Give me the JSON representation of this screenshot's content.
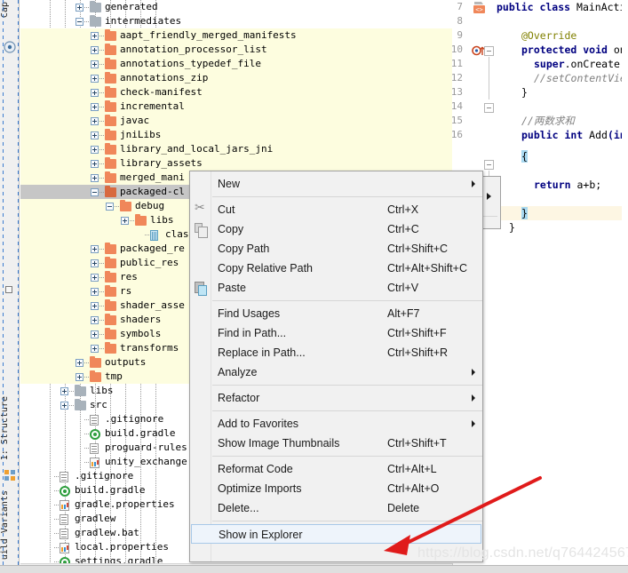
{
  "tool_tabs": [
    {
      "name": "capture-tab",
      "label": "Cap",
      "icon": "capture-icon"
    },
    {
      "name": "structure-tab",
      "label": "1: Structure",
      "icon": "structure-icon"
    },
    {
      "name": "build-variants-tab",
      "label": "uild Variants",
      "icon": "build-variants-icon"
    }
  ],
  "tree": {
    "rows": [
      {
        "label": "generated",
        "indent": 4,
        "icon": "folder-gray",
        "toggle": "plus",
        "highlight": "none"
      },
      {
        "label": "intermediates",
        "indent": 4,
        "icon": "folder-gray",
        "toggle": "minus",
        "highlight": "none"
      },
      {
        "label": "aapt_friendly_merged_manifests",
        "indent": 5,
        "icon": "folder-orange",
        "toggle": "plus",
        "highlight": "yellow"
      },
      {
        "label": "annotation_processor_list",
        "indent": 5,
        "icon": "folder-orange",
        "toggle": "plus",
        "highlight": "yellow"
      },
      {
        "label": "annotations_typedef_file",
        "indent": 5,
        "icon": "folder-orange",
        "toggle": "plus",
        "highlight": "yellow"
      },
      {
        "label": "annotations_zip",
        "indent": 5,
        "icon": "folder-orange",
        "toggle": "plus",
        "highlight": "yellow"
      },
      {
        "label": "check-manifest",
        "indent": 5,
        "icon": "folder-orange",
        "toggle": "plus",
        "highlight": "yellow"
      },
      {
        "label": "incremental",
        "indent": 5,
        "icon": "folder-orange",
        "toggle": "plus",
        "highlight": "yellow"
      },
      {
        "label": "javac",
        "indent": 5,
        "icon": "folder-orange",
        "toggle": "plus",
        "highlight": "yellow"
      },
      {
        "label": "jniLibs",
        "indent": 5,
        "icon": "folder-orange",
        "toggle": "plus",
        "highlight": "yellow"
      },
      {
        "label": "library_and_local_jars_jni",
        "indent": 5,
        "icon": "folder-orange",
        "toggle": "plus",
        "highlight": "yellow"
      },
      {
        "label": "library_assets",
        "indent": 5,
        "icon": "folder-orange",
        "toggle": "plus",
        "highlight": "yellow"
      },
      {
        "label": "merged_mani",
        "indent": 5,
        "icon": "folder-orange",
        "toggle": "plus",
        "highlight": "yellow"
      },
      {
        "label": "packaged-cl",
        "indent": 5,
        "icon": "folder-orange-dark",
        "toggle": "minus",
        "highlight": "selected"
      },
      {
        "label": "debug",
        "indent": 6,
        "icon": "folder-orange",
        "toggle": "minus",
        "highlight": "yellow"
      },
      {
        "label": "libs",
        "indent": 7,
        "icon": "folder-orange",
        "toggle": "plus",
        "highlight": "yellow"
      },
      {
        "label": "class",
        "indent": 8,
        "icon": "class-file",
        "toggle": "none",
        "highlight": "yellow"
      },
      {
        "label": "packaged_re",
        "indent": 5,
        "icon": "folder-orange",
        "toggle": "plus",
        "highlight": "yellow"
      },
      {
        "label": "public_res",
        "indent": 5,
        "icon": "folder-orange",
        "toggle": "plus",
        "highlight": "yellow"
      },
      {
        "label": "res",
        "indent": 5,
        "icon": "folder-orange",
        "toggle": "plus",
        "highlight": "yellow"
      },
      {
        "label": "rs",
        "indent": 5,
        "icon": "folder-orange",
        "toggle": "plus",
        "highlight": "yellow"
      },
      {
        "label": "shader_asse",
        "indent": 5,
        "icon": "folder-orange",
        "toggle": "plus",
        "highlight": "yellow"
      },
      {
        "label": "shaders",
        "indent": 5,
        "icon": "folder-orange",
        "toggle": "plus",
        "highlight": "yellow"
      },
      {
        "label": "symbols",
        "indent": 5,
        "icon": "folder-orange",
        "toggle": "plus",
        "highlight": "yellow"
      },
      {
        "label": "transforms",
        "indent": 5,
        "icon": "folder-orange",
        "toggle": "plus",
        "highlight": "yellow"
      },
      {
        "label": "outputs",
        "indent": 4,
        "icon": "folder-orange",
        "toggle": "plus",
        "highlight": "yellow"
      },
      {
        "label": "tmp",
        "indent": 4,
        "icon": "folder-orange",
        "toggle": "plus",
        "highlight": "yellow"
      },
      {
        "label": "libs",
        "indent": 3,
        "icon": "folder-gray",
        "toggle": "plus",
        "highlight": "none"
      },
      {
        "label": "src",
        "indent": 3,
        "icon": "folder-gray",
        "toggle": "plus",
        "highlight": "none"
      },
      {
        "label": ".gitignore",
        "indent": 4,
        "icon": "text-file",
        "toggle": "none",
        "highlight": "none"
      },
      {
        "label": "build.gradle",
        "indent": 4,
        "icon": "gradle-file",
        "toggle": "none",
        "highlight": "none"
      },
      {
        "label": "proguard-rules.pro",
        "indent": 4,
        "icon": "text-file",
        "toggle": "none",
        "highlight": "none"
      },
      {
        "label": "unity_exchange.iml",
        "indent": 4,
        "icon": "iml-file",
        "toggle": "none",
        "highlight": "none"
      },
      {
        "label": ".gitignore",
        "indent": 2,
        "icon": "text-file",
        "toggle": "none",
        "highlight": "none"
      },
      {
        "label": "build.gradle",
        "indent": 2,
        "icon": "gradle-file",
        "toggle": "none",
        "highlight": "none"
      },
      {
        "label": "gradle.properties",
        "indent": 2,
        "icon": "properties-file",
        "toggle": "none",
        "highlight": "none"
      },
      {
        "label": "gradlew",
        "indent": 2,
        "icon": "text-file",
        "toggle": "none",
        "highlight": "none"
      },
      {
        "label": "gradlew.bat",
        "indent": 2,
        "icon": "text-file",
        "toggle": "none",
        "highlight": "none"
      },
      {
        "label": "local.properties",
        "indent": 2,
        "icon": "properties-file",
        "toggle": "none",
        "highlight": "none"
      },
      {
        "label": "settings.gradle",
        "indent": 2,
        "icon": "gradle-file",
        "toggle": "none",
        "highlight": "none"
      }
    ]
  },
  "context_menu": {
    "items": [
      {
        "label": "New",
        "accel": "",
        "submenu": true,
        "icon": "",
        "separator_after": true,
        "selected": false
      },
      {
        "label": "Cut",
        "accel": "Ctrl+X",
        "submenu": false,
        "icon": "cut-icon",
        "separator_after": false,
        "selected": false
      },
      {
        "label": "Copy",
        "accel": "Ctrl+C",
        "submenu": false,
        "icon": "copy-icon",
        "separator_after": false,
        "selected": false
      },
      {
        "label": "Copy Path",
        "accel": "Ctrl+Shift+C",
        "submenu": false,
        "icon": "",
        "separator_after": false,
        "selected": false
      },
      {
        "label": "Copy Relative Path",
        "accel": "Ctrl+Alt+Shift+C",
        "submenu": false,
        "icon": "",
        "separator_after": false,
        "selected": false
      },
      {
        "label": "Paste",
        "accel": "Ctrl+V",
        "submenu": false,
        "icon": "paste-icon",
        "separator_after": true,
        "selected": false
      },
      {
        "label": "Find Usages",
        "accel": "Alt+F7",
        "submenu": false,
        "icon": "",
        "separator_after": false,
        "selected": false
      },
      {
        "label": "Find in Path...",
        "accel": "Ctrl+Shift+F",
        "submenu": false,
        "icon": "",
        "separator_after": false,
        "selected": false
      },
      {
        "label": "Replace in Path...",
        "accel": "Ctrl+Shift+R",
        "submenu": false,
        "icon": "",
        "separator_after": false,
        "selected": false
      },
      {
        "label": "Analyze",
        "accel": "",
        "submenu": true,
        "icon": "",
        "separator_after": true,
        "selected": false
      },
      {
        "label": "Refactor",
        "accel": "",
        "submenu": true,
        "icon": "",
        "separator_after": true,
        "selected": false
      },
      {
        "label": "Add to Favorites",
        "accel": "",
        "submenu": true,
        "icon": "",
        "separator_after": false,
        "selected": false
      },
      {
        "label": "Show Image Thumbnails",
        "accel": "Ctrl+Shift+T",
        "submenu": false,
        "icon": "",
        "separator_after": true,
        "selected": false
      },
      {
        "label": "Reformat Code",
        "accel": "Ctrl+Alt+L",
        "submenu": false,
        "icon": "",
        "separator_after": false,
        "selected": false
      },
      {
        "label": "Optimize Imports",
        "accel": "Ctrl+Alt+O",
        "submenu": false,
        "icon": "",
        "separator_after": false,
        "selected": false
      },
      {
        "label": "Delete...",
        "accel": "Delete",
        "submenu": false,
        "icon": "",
        "separator_after": true,
        "selected": false
      },
      {
        "label": "Show in Explorer",
        "accel": "",
        "submenu": false,
        "icon": "",
        "separator_after": false,
        "selected": true
      }
    ]
  },
  "editor": {
    "line_numbers": [
      "7",
      "8",
      "9",
      "10",
      "11",
      "12",
      "13",
      "14",
      "15",
      "16"
    ],
    "lines": [
      {
        "indent": 0,
        "segments": [
          {
            "t": "public class ",
            "c": "kw"
          },
          {
            "t": "MainActivi",
            "c": "plain"
          }
        ]
      },
      {
        "indent": 0,
        "segments": []
      },
      {
        "indent": 2,
        "segments": [
          {
            "t": "@Override",
            "c": "ann"
          }
        ]
      },
      {
        "indent": 2,
        "segments": [
          {
            "t": "protected void ",
            "c": "kw"
          },
          {
            "t": "onCr",
            "c": "plain"
          }
        ]
      },
      {
        "indent": 3,
        "segments": [
          {
            "t": "super",
            "c": "kw"
          },
          {
            "t": ".onCreate(s",
            "c": "plain"
          }
        ]
      },
      {
        "indent": 3,
        "segments": [
          {
            "t": "//setContentView",
            "c": "cmt"
          }
        ]
      },
      {
        "indent": 2,
        "segments": [
          {
            "t": "}",
            "c": "plain"
          }
        ]
      },
      {
        "indent": 0,
        "segments": []
      },
      {
        "indent": 2,
        "segments": [
          {
            "t": "//两数求和",
            "c": "cmt"
          }
        ]
      },
      {
        "indent": 2,
        "segments": [
          {
            "t": "public int ",
            "c": "kw"
          },
          {
            "t": "Add",
            "c": "plain"
          },
          {
            "t": "(int",
            "c": "kw"
          }
        ]
      }
    ],
    "extra_lines": [
      {
        "text": "{",
        "class": "brace-hl",
        "indent": 2
      },
      {
        "text": "return ",
        "class": "kw",
        "indent": 3,
        "tail": "a+b;"
      },
      {
        "text": "}",
        "class": "brace-hl",
        "indent": 2
      },
      {
        "text": "}",
        "class": "plain",
        "indent": 1
      }
    ],
    "class_marker": "class-marker-icon",
    "override_marker": "override-method-icon"
  },
  "watermark": {
    "text": "https://blog.csdn.net/q764424567"
  },
  "colors": {
    "tree_highlight": "#fdfddf",
    "tree_selected": "#c6c6c6",
    "menu_bg": "#f1f1f1",
    "menu_selected": "#eef4fb",
    "folder_orange": "#f0875a",
    "folder_gray": "#a8b2bb",
    "keyword_blue": "#000080",
    "annotation_olive": "#808000",
    "comment_gray": "#808080",
    "arrow_red": "#e01b1b",
    "accent_blue": "#3a7bd0"
  }
}
